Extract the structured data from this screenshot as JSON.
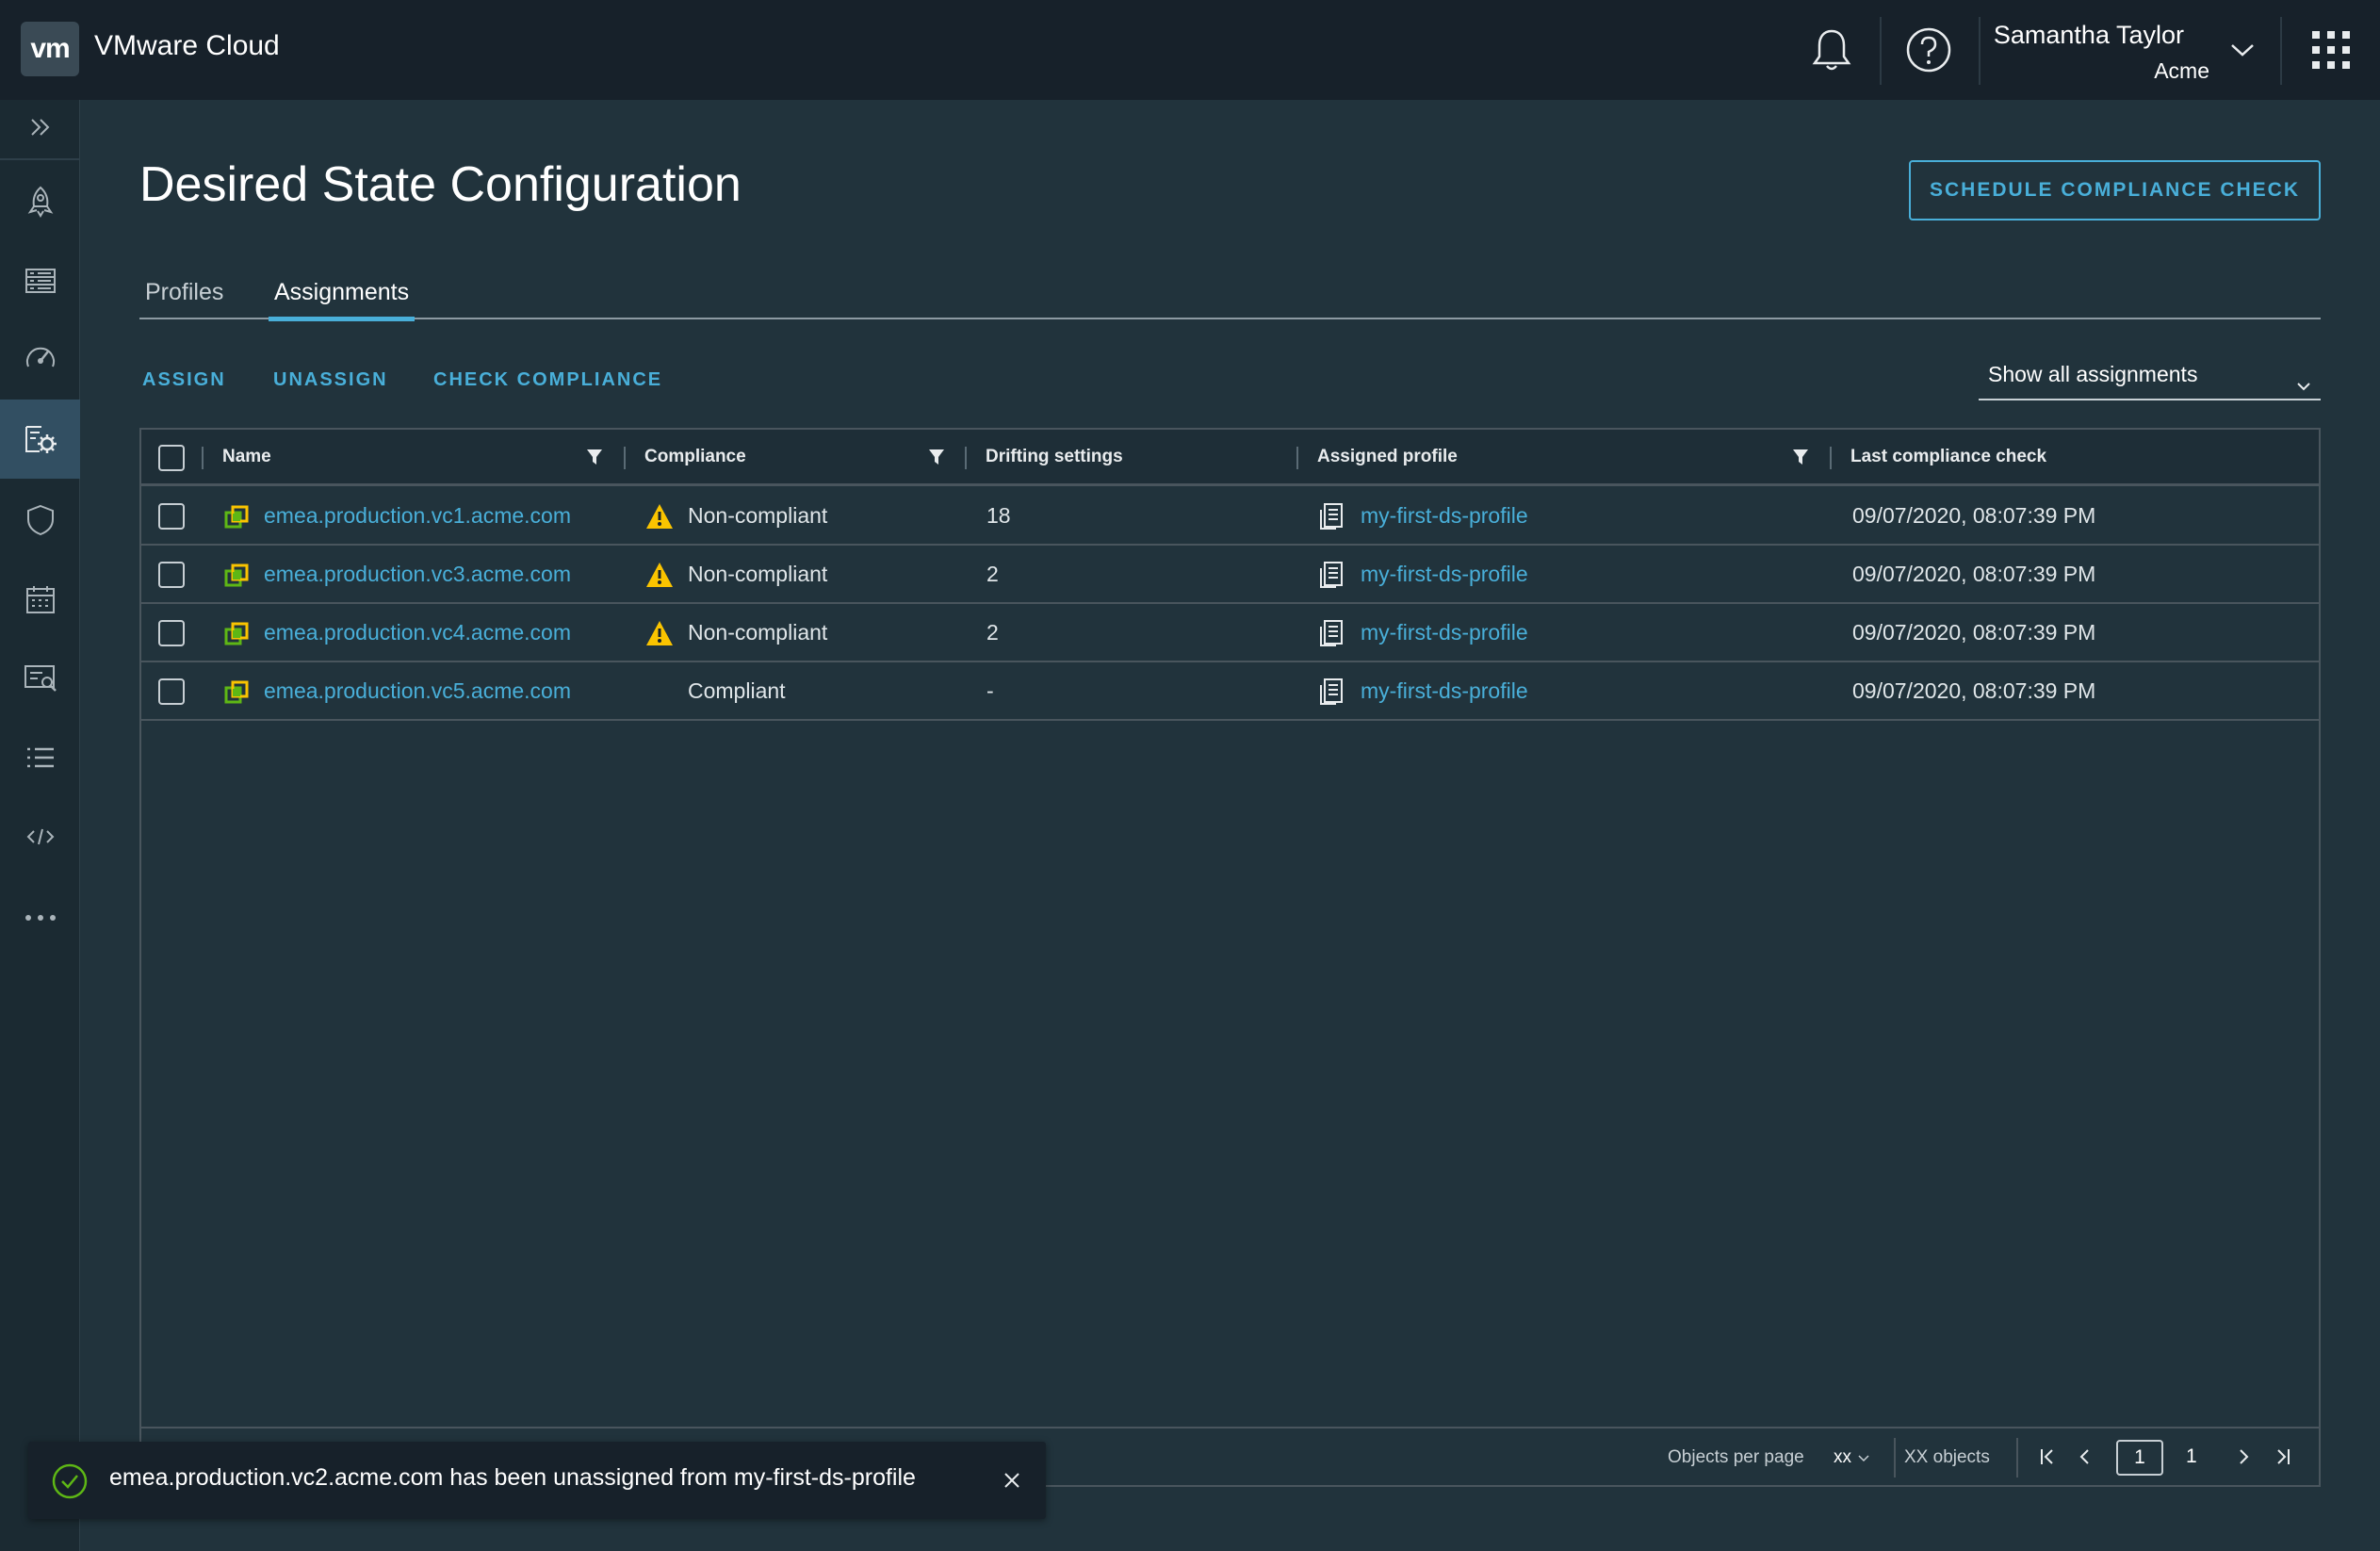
{
  "header": {
    "logo": "vm",
    "app_title": "VMware Cloud",
    "user_name": "Samantha Taylor",
    "user_org": "Acme"
  },
  "sidebar": {
    "items": [
      {
        "icon": "expand-icon"
      },
      {
        "icon": "rocket-icon"
      },
      {
        "icon": "inventory-list-icon"
      },
      {
        "icon": "dashboard-gauge-icon"
      },
      {
        "icon": "configuration-icon",
        "active": true
      },
      {
        "icon": "shield-icon"
      },
      {
        "icon": "calendar-icon"
      },
      {
        "icon": "search-report-icon"
      },
      {
        "icon": "list-icon"
      },
      {
        "icon": "code-icon"
      },
      {
        "icon": "more-icon"
      }
    ]
  },
  "page": {
    "title": "Desired State Configuration",
    "schedule_button": "SCHEDULE COMPLIANCE CHECK",
    "tabs": [
      {
        "label": "Profiles",
        "active": false
      },
      {
        "label": "Assignments",
        "active": true
      }
    ],
    "actions": {
      "assign": "ASSIGN",
      "unassign": "UNASSIGN",
      "check_compliance": "CHECK COMPLIANCE"
    },
    "filter_select": "Show all assignments"
  },
  "grid": {
    "columns": {
      "name": "Name",
      "compliance": "Compliance",
      "drifting": "Drifting settings",
      "profile": "Assigned profile",
      "last_check": "Last compliance check"
    },
    "rows": [
      {
        "name": "emea.production.vc1.acme.com",
        "compliance": "Non-compliant",
        "warning": true,
        "drifting": "18",
        "profile": "my-first-ds-profile",
        "last_check": "09/07/2020, 08:07:39 PM"
      },
      {
        "name": "emea.production.vc3.acme.com",
        "compliance": "Non-compliant",
        "warning": true,
        "drifting": "2",
        "profile": "my-first-ds-profile",
        "last_check": "09/07/2020, 08:07:39 PM"
      },
      {
        "name": "emea.production.vc4.acme.com",
        "compliance": "Non-compliant",
        "warning": true,
        "drifting": "2",
        "profile": "my-first-ds-profile",
        "last_check": "09/07/2020, 08:07:39 PM"
      },
      {
        "name": "emea.production.vc5.acme.com",
        "compliance": "Compliant",
        "warning": false,
        "drifting": "-",
        "profile": "my-first-ds-profile",
        "last_check": "09/07/2020, 08:07:39 PM"
      }
    ],
    "footer": {
      "per_page_label": "Objects per page",
      "per_page_value": "xx",
      "objects_count": "XX objects",
      "current_page": "1",
      "total_pages": "1"
    }
  },
  "toast": {
    "message": "emea.production.vc2.acme.com has been unassigned from my-first-ds-profile"
  },
  "colors": {
    "accent": "#49afd9",
    "warning": "#fac400",
    "success": "#5eb715",
    "header_bg": "#17212a",
    "content_bg": "#21333c"
  }
}
